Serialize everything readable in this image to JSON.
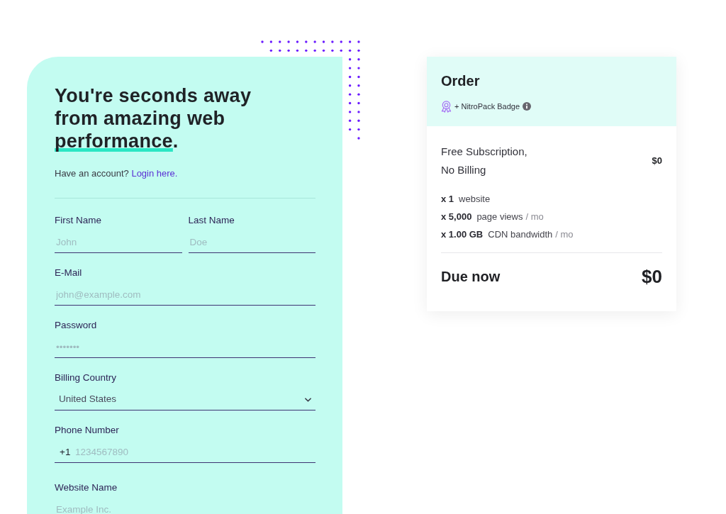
{
  "signup_form": {
    "heading": [
      {
        "text": "You're seconds away from amazing web ",
        "highlight": false
      },
      {
        "text": "performance",
        "highlight": true
      },
      {
        "text": ".",
        "highlight": false
      }
    ],
    "account_prompt": {
      "text": "Have an account?",
      "link": "Login here."
    },
    "field_rows": [
      [
        {
          "kind": "text",
          "label": "First Name",
          "placeholder": "John"
        },
        {
          "kind": "text",
          "label": "Last Name",
          "placeholder": "Doe"
        }
      ],
      [
        {
          "kind": "text",
          "label": "E-Mail",
          "placeholder": "john@example.com"
        }
      ],
      [
        {
          "kind": "password",
          "label": "Password",
          "placeholder": "•••••••"
        }
      ],
      [
        {
          "kind": "select",
          "label": "Billing Country",
          "value": "United States"
        }
      ],
      [
        {
          "kind": "phone",
          "label": "Phone Number",
          "prefix": "+1",
          "placeholder": "1234567890"
        }
      ],
      [
        {
          "kind": "text",
          "label": "Website Name",
          "placeholder": "Example Inc."
        }
      ]
    ]
  },
  "order_summary": {
    "title": "Order",
    "badge": "+ NitroPack Badge",
    "plan": {
      "name": "Free Subscription, No Billing",
      "price": "$0"
    },
    "features": [
      {
        "quantity": "x 1",
        "label": "website"
      },
      {
        "quantity": "x 5,000",
        "label": "page views",
        "unit": "/ mo"
      },
      {
        "quantity": "x 1.00 GB",
        "label": "CDN bandwidth",
        "unit": "/ mo"
      }
    ],
    "total": {
      "label": "Due now",
      "amount": "$0"
    }
  }
}
